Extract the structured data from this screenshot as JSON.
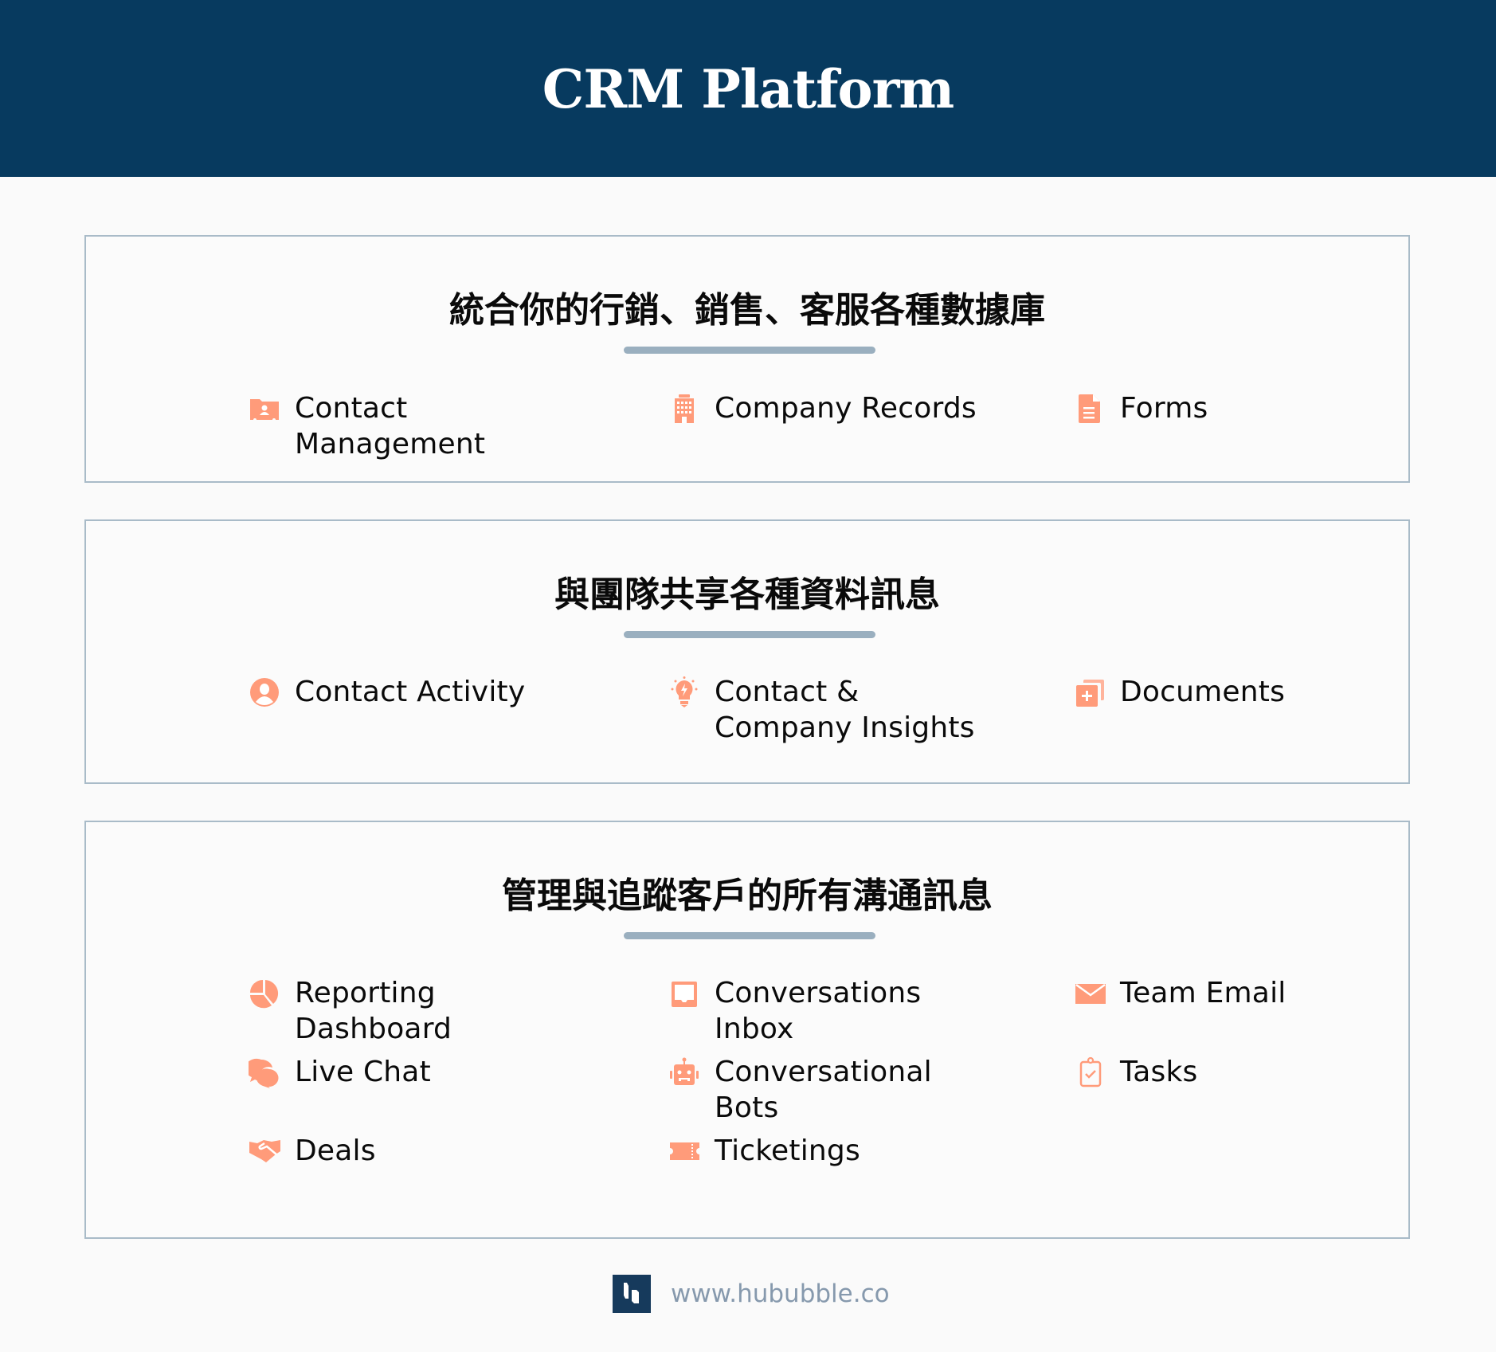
{
  "header": {
    "title": "CRM Platform"
  },
  "colors": {
    "header_bg": "#073a5f",
    "icon": "#ff9b7a",
    "divider": "#9aafbf",
    "border": "#a9bbc8",
    "footer_text": "#8699ad"
  },
  "sections": [
    {
      "title": "統合你的行銷、銷售、客服各種數據庫",
      "items": [
        {
          "label": "Contact Management",
          "icon": "contact-folder-icon"
        },
        {
          "label": "Company Records",
          "icon": "building-icon"
        },
        {
          "label": "Forms",
          "icon": "document-icon"
        }
      ]
    },
    {
      "title": "與團隊共享各種資料訊息",
      "items": [
        {
          "label": "Contact Activity",
          "icon": "user-circle-icon"
        },
        {
          "label": "Contact & Company Insights",
          "icon": "lightbulb-icon"
        },
        {
          "label": "Documents",
          "icon": "documents-add-icon"
        }
      ]
    },
    {
      "title": "管理與追蹤客戶的所有溝通訊息",
      "items": [
        {
          "label": "Reporting Dashboard",
          "icon": "pie-chart-icon"
        },
        {
          "label": "Conversations Inbox",
          "icon": "inbox-icon"
        },
        {
          "label": "Team Email",
          "icon": "envelope-icon"
        },
        {
          "label": "Live Chat",
          "icon": "chat-bubbles-icon"
        },
        {
          "label": "Conversational Bots",
          "icon": "robot-icon"
        },
        {
          "label": "Tasks",
          "icon": "clipboard-check-icon"
        },
        {
          "label": "Deals",
          "icon": "handshake-icon"
        },
        {
          "label": "Ticketings",
          "icon": "ticket-icon"
        }
      ]
    }
  ],
  "footer": {
    "url": "www.hububble.co",
    "logo": "hububble-logo-icon"
  }
}
